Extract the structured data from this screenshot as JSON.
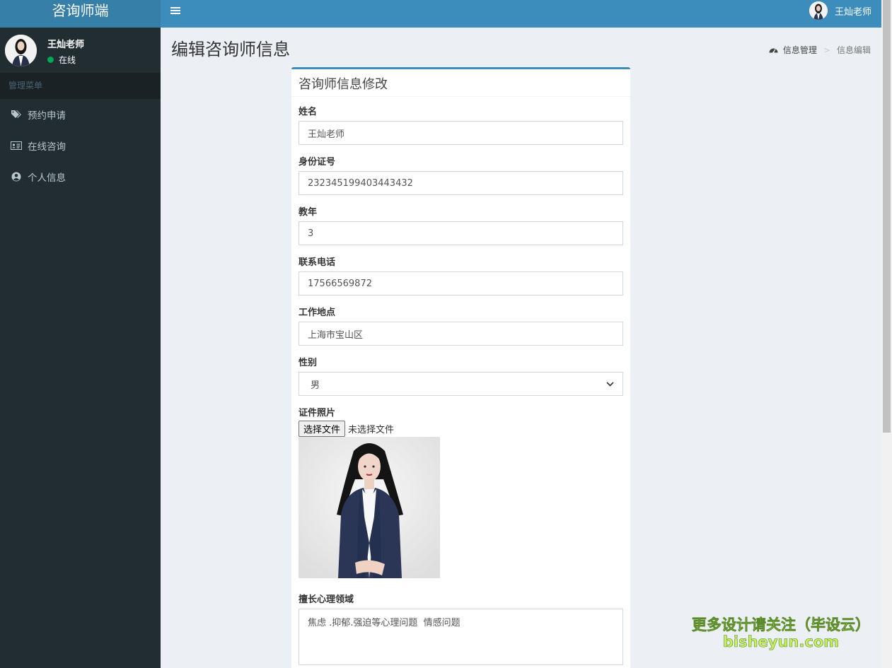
{
  "app": {
    "title": "咨询师端"
  },
  "header": {
    "user_name": "王灿老师"
  },
  "sidebar": {
    "user_name": "王灿老师",
    "status": "在线",
    "menu_header": "管理菜单",
    "items": [
      {
        "label": "预约申请",
        "icon": "tags-icon"
      },
      {
        "label": "在线咨询",
        "icon": "id-card-icon"
      },
      {
        "label": "个人信息",
        "icon": "user-circle-icon"
      }
    ]
  },
  "page": {
    "title": "编辑咨询师信息",
    "breadcrumb": {
      "root": "信息管理",
      "separator": ">",
      "current": "信息编辑"
    }
  },
  "form": {
    "title": "咨询师信息修改",
    "fields": {
      "name": {
        "label": "姓名",
        "value": "王灿老师"
      },
      "id_number": {
        "label": "身份证号",
        "value": "232345199403443432"
      },
      "teaching_years": {
        "label": "教年",
        "value": "3"
      },
      "phone": {
        "label": "联系电话",
        "value": "17566569872"
      },
      "work_location": {
        "label": "工作地点",
        "value": "上海市宝山区"
      },
      "gender": {
        "label": "性别",
        "value": "男"
      },
      "photo": {
        "label": "证件照片",
        "button": "选择文件",
        "status": "未选择文件"
      },
      "specialty": {
        "label": "擅长心理领域",
        "value": "焦虑 .抑郁.强迫等心理问题  情感问题"
      }
    }
  },
  "watermark": {
    "line1": "更多设计请关注（毕设云）",
    "line2": "bisheyun.com"
  },
  "colors": {
    "navbar": "#3c8dbc",
    "logo_bg": "#367fa9",
    "sidebar": "#222d32",
    "online": "#00a65a"
  }
}
